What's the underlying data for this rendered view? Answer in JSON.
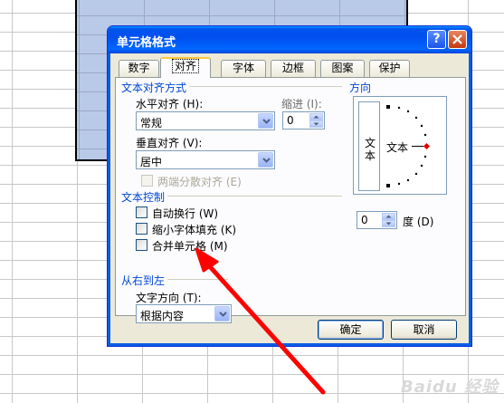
{
  "dialog": {
    "title": "单元格格式",
    "help_icon": "?",
    "close_icon": "✕"
  },
  "tabs": [
    {
      "label": "数字",
      "active": false
    },
    {
      "label": "对齐",
      "active": true
    },
    {
      "label": "字体",
      "active": false
    },
    {
      "label": "边框",
      "active": false
    },
    {
      "label": "图案",
      "active": false
    },
    {
      "label": "保护",
      "active": false
    }
  ],
  "alignment": {
    "group_label": "文本对齐方式",
    "horizontal_label": "水平对齐 (H):",
    "horizontal_value": "常规",
    "indent_label": "缩进 (I):",
    "indent_value": "0",
    "vertical_label": "垂直对齐 (V):",
    "vertical_value": "居中",
    "justify_distributed_label": "两端分散对齐 (E)"
  },
  "text_control": {
    "group_label": "文本控制",
    "wrap_text_label": "自动换行 (W)",
    "shrink_to_fit_label": "缩小字体填充 (K)",
    "merge_cells_label": "合并单元格 (M)"
  },
  "rtl": {
    "group_label": "从右到左",
    "direction_label": "文字方向 (T):",
    "direction_value": "根据内容"
  },
  "orientation": {
    "group_label": "方向",
    "vertical_text": "文本",
    "horizontal_text": "文本",
    "degrees_value": "0",
    "degrees_label": "度 (D)"
  },
  "footer": {
    "ok_label": "确定",
    "cancel_label": "取消"
  },
  "colors": {
    "title_bar": "#0054e3",
    "group_label": "#0046d5",
    "annotation_arrow": "#ff0000",
    "selection": "#b9c9e8"
  },
  "watermark": "Baidu 经验"
}
